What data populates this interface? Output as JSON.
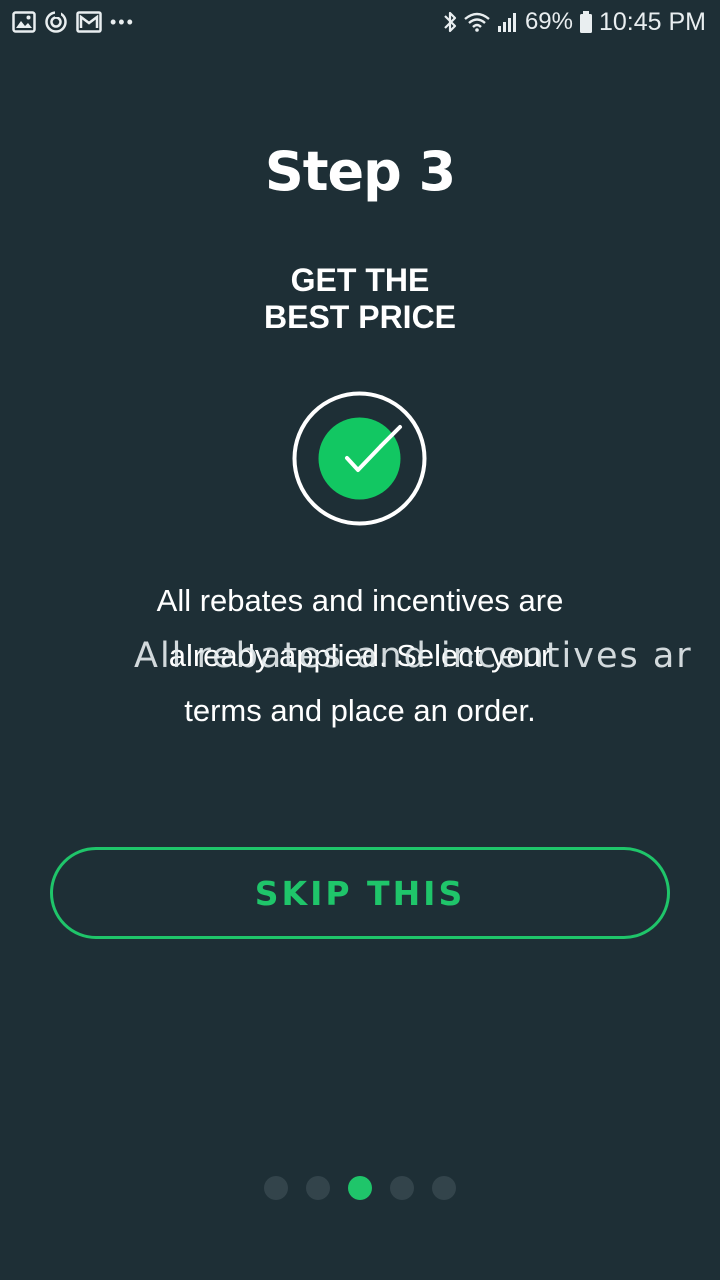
{
  "status_bar": {
    "left_icons": [
      "gallery-icon",
      "sync-icon",
      "gmail-icon",
      "more-dots-icon"
    ],
    "more_dots": "•••",
    "battery_percent": "69%",
    "time": "10:45 PM",
    "right_icons": [
      "bluetooth-icon",
      "wifi-icon",
      "signal-icon",
      "battery-icon"
    ]
  },
  "onboarding": {
    "title": "Step 3",
    "subtitle_lines": [
      "GET THE",
      "BEST PRICE"
    ],
    "badge_icon": "check-circle-icon",
    "description_lines": [
      "All rebates and incentives are",
      "already applied. Select your",
      "terms and place an order."
    ],
    "ghost_text": "All rebates and incentives ar",
    "skip_label": "SKIP THIS"
  },
  "pager": {
    "total": 5,
    "active_index": 2
  },
  "colors": {
    "background": "#1e2f36",
    "accent_green": "#1fc56a",
    "check_fill": "#12c762",
    "dot_inactive": "#33444b",
    "text": "#ffffff"
  }
}
